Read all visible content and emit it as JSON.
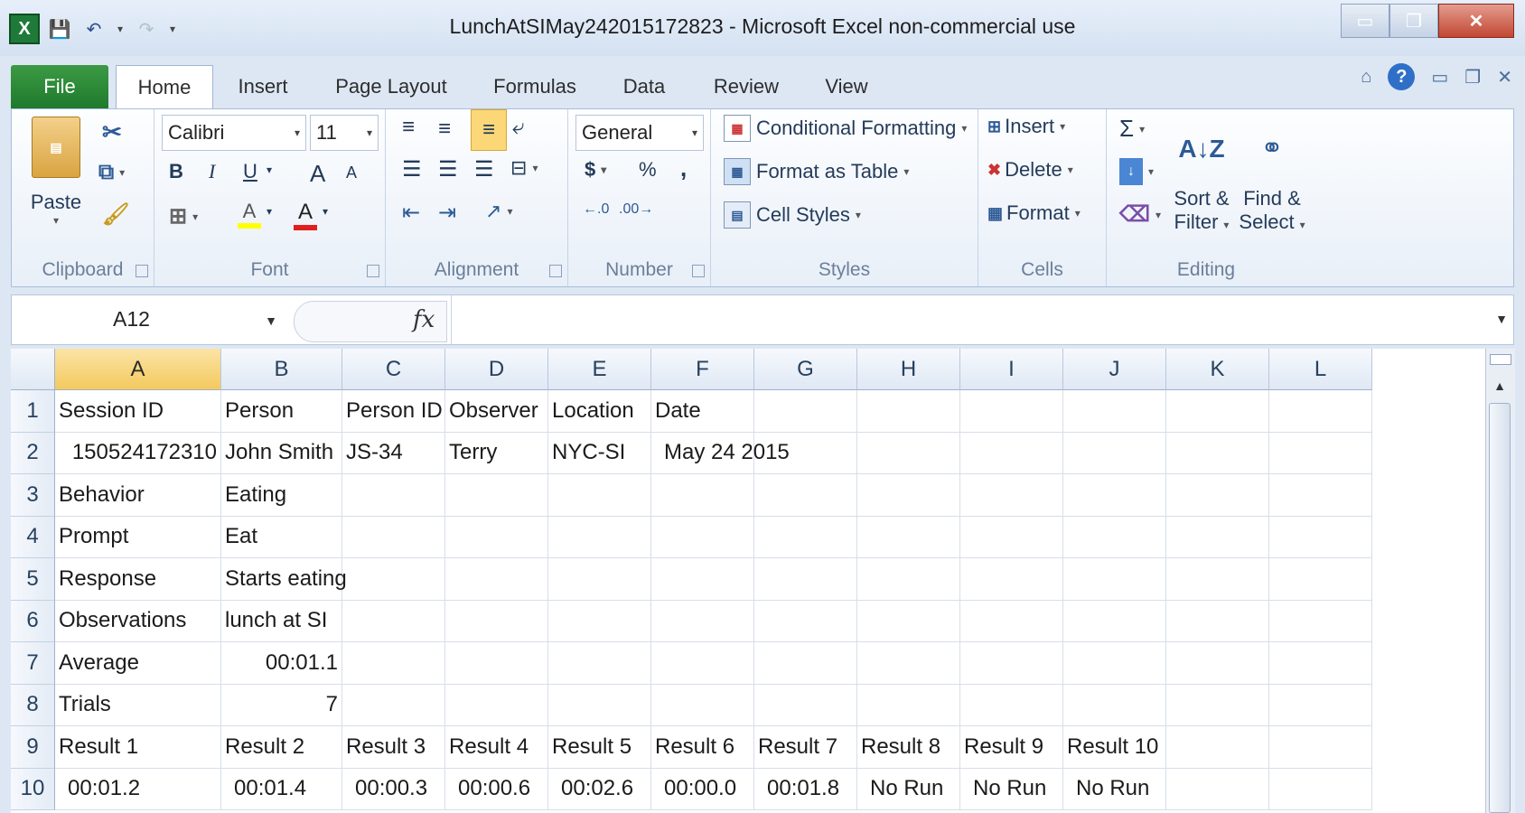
{
  "window": {
    "title": "LunchAtSIMay242015172823  -  Microsoft Excel non-commercial use",
    "minimize": "▭",
    "maximize": "❐",
    "close": "✕"
  },
  "qat": {
    "app_icon": "X",
    "save_icon": "💾",
    "undo_icon": "↶",
    "redo_icon": "↷",
    "customize_icon": "▾"
  },
  "tabs": [
    "File",
    "Home",
    "Insert",
    "Page Layout",
    "Formulas",
    "Data",
    "Review",
    "View"
  ],
  "ribbon": {
    "clipboard": {
      "label": "Clipboard",
      "paste": "Paste"
    },
    "font": {
      "label": "Font",
      "name": "Calibri",
      "size": "11",
      "bold": "B",
      "italic": "I",
      "underline": "U",
      "grow": "A",
      "shrink": "A",
      "fill": "A",
      "color": "A"
    },
    "alignment": {
      "label": "Alignment"
    },
    "number": {
      "label": "Number",
      "format": "General",
      "currency": "$",
      "percent": "%",
      "comma": ","
    },
    "styles": {
      "label": "Styles",
      "conditional": "Conditional Formatting",
      "format_table": "Format as Table",
      "cell_styles": "Cell Styles"
    },
    "cells": {
      "label": "Cells",
      "insert": "Insert",
      "delete": "Delete",
      "format": "Format"
    },
    "editing": {
      "label": "Editing",
      "sort": "Sort &",
      "filter": "Filter",
      "find": "Find &",
      "select": "Select",
      "sigma": "Σ"
    }
  },
  "formula_bar": {
    "name_box": "A12",
    "fx": "fx",
    "value": ""
  },
  "sheet": {
    "columns": [
      "A",
      "B",
      "C",
      "D",
      "E",
      "F",
      "G",
      "H",
      "I",
      "J",
      "K",
      "L"
    ],
    "selected_column": "A",
    "rows": [
      [
        "Session ID",
        "Person",
        "Person ID",
        "Observer",
        "Location",
        "Date",
        "",
        "",
        "",
        "",
        "",
        ""
      ],
      [
        "150524172310",
        "John Smith",
        "JS-34",
        "Terry",
        "NYC-SI",
        "May 24 2015",
        "",
        "",
        "",
        "",
        "",
        ""
      ],
      [
        "Behavior",
        "Eating",
        "",
        "",
        "",
        "",
        "",
        "",
        "",
        "",
        "",
        ""
      ],
      [
        "Prompt",
        "Eat",
        "",
        "",
        "",
        "",
        "",
        "",
        "",
        "",
        "",
        ""
      ],
      [
        "Response",
        "Starts eating",
        "",
        "",
        "",
        "",
        "",
        "",
        "",
        "",
        "",
        ""
      ],
      [
        "Observations",
        "lunch at SI",
        "",
        "",
        "",
        "",
        "",
        "",
        "",
        "",
        "",
        ""
      ],
      [
        "Average",
        "00:01.1",
        "",
        "",
        "",
        "",
        "",
        "",
        "",
        "",
        "",
        ""
      ],
      [
        "Trials",
        "7",
        "",
        "",
        "",
        "",
        "",
        "",
        "",
        "",
        "",
        ""
      ],
      [
        "Result 1",
        "Result 2",
        "Result 3",
        "Result 4",
        "Result 5",
        "Result 6",
        "Result 7",
        "Result 8",
        "Result 9",
        "Result 10",
        "",
        ""
      ],
      [
        "00:01.2",
        "00:01.4",
        "00:00.3",
        "00:00.6",
        "00:02.6",
        "00:00.0",
        "00:01.8",
        "No Run",
        "No Run",
        "No Run",
        "",
        ""
      ]
    ],
    "right_aligned": [
      "1-0",
      "6-1",
      "7-1"
    ],
    "padded": [
      "9-0",
      "9-1",
      "9-2",
      "9-3",
      "9-4",
      "9-5",
      "9-6",
      "9-7",
      "9-8",
      "9-9",
      "1-5"
    ]
  }
}
